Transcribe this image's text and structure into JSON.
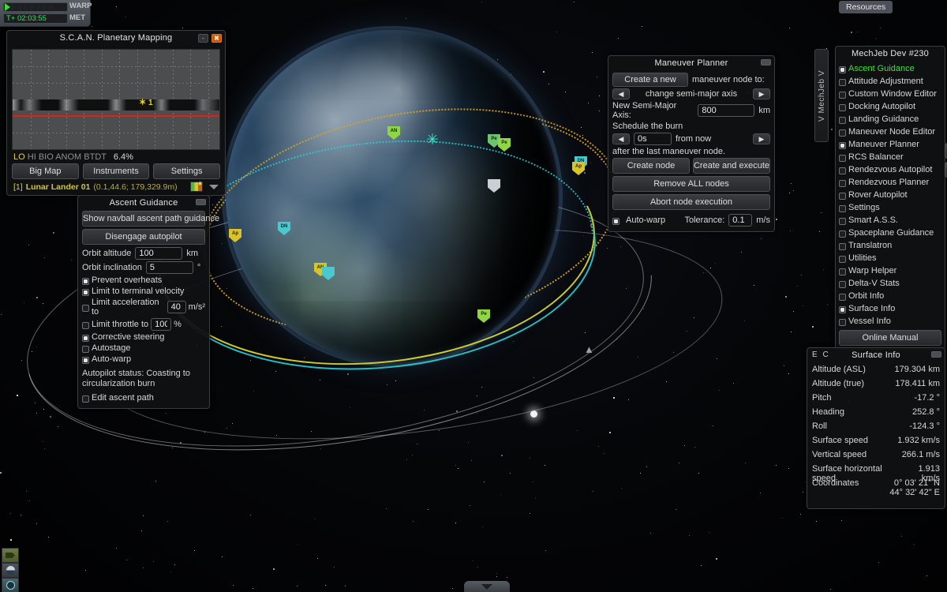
{
  "hud": {
    "warp_label": "WARP",
    "met_label": "MET",
    "met_value": "T+ 02:03:55",
    "warp_active_steps": 1,
    "warp_total_steps": 8,
    "resources_label": "Resources"
  },
  "scan_window": {
    "title": "S.C.A.N. Planetary Mapping",
    "minimize_label": "-",
    "close_label": "✖",
    "legend": [
      "LO",
      "HI",
      "BIO",
      "ANOM",
      "BTDT"
    ],
    "coverage_pct": "6.4%",
    "buttons": [
      "Big Map",
      "Instruments",
      "Settings"
    ],
    "vessel_index": "[1]",
    "vessel_name": "Lunar Lander 01",
    "vessel_coords": "(0.1,44.6; 179,329.9m)",
    "map_marker_label": "1"
  },
  "ascent_guidance": {
    "title": "Ascent Guidance",
    "show_navball_button": "Show navball ascent path guidance",
    "disengage_button": "Disengage autopilot",
    "fields": [
      {
        "label": "Orbit altitude",
        "value": "100",
        "unit": "km"
      },
      {
        "label": "Orbit inclination",
        "value": "5",
        "unit": "°"
      }
    ],
    "checkboxes": [
      {
        "label": "Prevent overheats",
        "checked": true
      },
      {
        "label": "Limit to terminal velocity",
        "checked": true
      },
      {
        "label": "Limit acceleration to",
        "checked": false,
        "value": "40",
        "unit": "m/s²"
      },
      {
        "label": "Limit throttle to",
        "checked": false,
        "value": "100",
        "unit": "%"
      },
      {
        "label": "Corrective steering",
        "checked": true
      },
      {
        "label": "Autostage",
        "checked": false
      },
      {
        "label": "Auto-warp",
        "checked": true
      }
    ],
    "status": "Autopilot status: Coasting to circularization burn",
    "edit_ascent_path": {
      "label": "Edit ascent path",
      "checked": false
    }
  },
  "maneuver_planner": {
    "title": "Maneuver Planner",
    "create_new_button": "Create a new",
    "create_new_suffix": "maneuver node to:",
    "selector_prev": "◀",
    "selector_next": "▶",
    "selector_value": "change semi-major axis",
    "semi_major_label": "New Semi-Major Axis:",
    "semi_major_value": "800",
    "semi_major_unit": "km",
    "schedule_label": "Schedule the burn",
    "schedule_prev": "◀",
    "schedule_next": "▶",
    "schedule_value": "0s",
    "schedule_suffix": "from now",
    "schedule_note": "after the last maneuver node.",
    "create_node_button": "Create node",
    "create_execute_button": "Create and execute",
    "remove_all_button": "Remove ALL nodes",
    "abort_button": "Abort node execution",
    "autowarp_label": "Auto-warp",
    "autowarp_checked": true,
    "tolerance_label": "Tolerance:",
    "tolerance_value": "0.1",
    "tolerance_unit": "m/s"
  },
  "mechjeb": {
    "tab_label": "V MechJeb V",
    "title": "MechJeb Dev #230",
    "items": [
      {
        "label": "Ascent Guidance",
        "checked": true,
        "active": true
      },
      {
        "label": "Attitude Adjustment",
        "checked": false
      },
      {
        "label": "Custom Window Editor",
        "checked": false
      },
      {
        "label": "Docking Autopilot",
        "checked": false
      },
      {
        "label": "Landing Guidance",
        "checked": false
      },
      {
        "label": "Maneuver Node Editor",
        "checked": false
      },
      {
        "label": "Maneuver Planner",
        "checked": true
      },
      {
        "label": "RCS Balancer",
        "checked": false
      },
      {
        "label": "Rendezvous Autopilot",
        "checked": false
      },
      {
        "label": "Rendezvous Planner",
        "checked": false
      },
      {
        "label": "Rover Autopilot",
        "checked": false
      },
      {
        "label": "Settings",
        "checked": false
      },
      {
        "label": "Smart A.S.S.",
        "checked": false
      },
      {
        "label": "Spaceplane Guidance",
        "checked": false
      },
      {
        "label": "Translatron",
        "checked": false
      },
      {
        "label": "Utilities",
        "checked": false
      },
      {
        "label": "Warp Helper",
        "checked": false
      },
      {
        "label": "Delta-V Stats",
        "checked": false
      },
      {
        "label": "Orbit Info",
        "checked": false
      },
      {
        "label": "Surface Info",
        "checked": true
      },
      {
        "label": "Vessel Info",
        "checked": false
      }
    ],
    "online_manual_button": "Online Manual",
    "side_buttons": [
      "info-icon",
      "mechjeb-core-icon"
    ]
  },
  "surface_info": {
    "title": "Surface Info",
    "edit_copy_label": "E C",
    "rows": [
      {
        "label": "Altitude (ASL)",
        "value": "179.304 km"
      },
      {
        "label": "Altitude (true)",
        "value": "178.411 km"
      },
      {
        "label": "Pitch",
        "value": "-17.2 °"
      },
      {
        "label": "Heading",
        "value": "252.8 °"
      },
      {
        "label": "Roll",
        "value": "-124.3 °"
      },
      {
        "label": "Surface speed",
        "value": "1.932 km/s"
      },
      {
        "label": "Vertical speed",
        "value": "266.1 m/s"
      },
      {
        "label": "Surface horizontal speed",
        "value": "1.913 km/s"
      },
      {
        "label": "Coordinates",
        "value": "0° 03' 21\" N\n44° 32' 42\" E"
      }
    ]
  },
  "map_markers": [
    {
      "name": "maneuver-node-marker",
      "label": "AN",
      "color": "grn"
    },
    {
      "name": "periapsis-marker",
      "label": "Pe",
      "color": "grn"
    },
    {
      "name": "apoapsis-marker",
      "label": "Ap",
      "color": "ylw"
    },
    {
      "name": "descending-node-marker",
      "label": "DN",
      "color": "teal"
    },
    {
      "name": "target-marker",
      "label": "",
      "color": "wht"
    }
  ],
  "colors": {
    "accent_green": "#3fe23f",
    "orbit_yellow": "#d8d62a",
    "orbit_cyan": "#2ad0d6",
    "orbit_orange": "#d9a422",
    "scan_red": "#f21717",
    "met_green": "#45e06a"
  },
  "bottom_bar": {
    "app_icons": [
      "vessel-icon",
      "navball-icon",
      "radar-icon"
    ],
    "navball_tab": "navball-collapse-tab"
  }
}
